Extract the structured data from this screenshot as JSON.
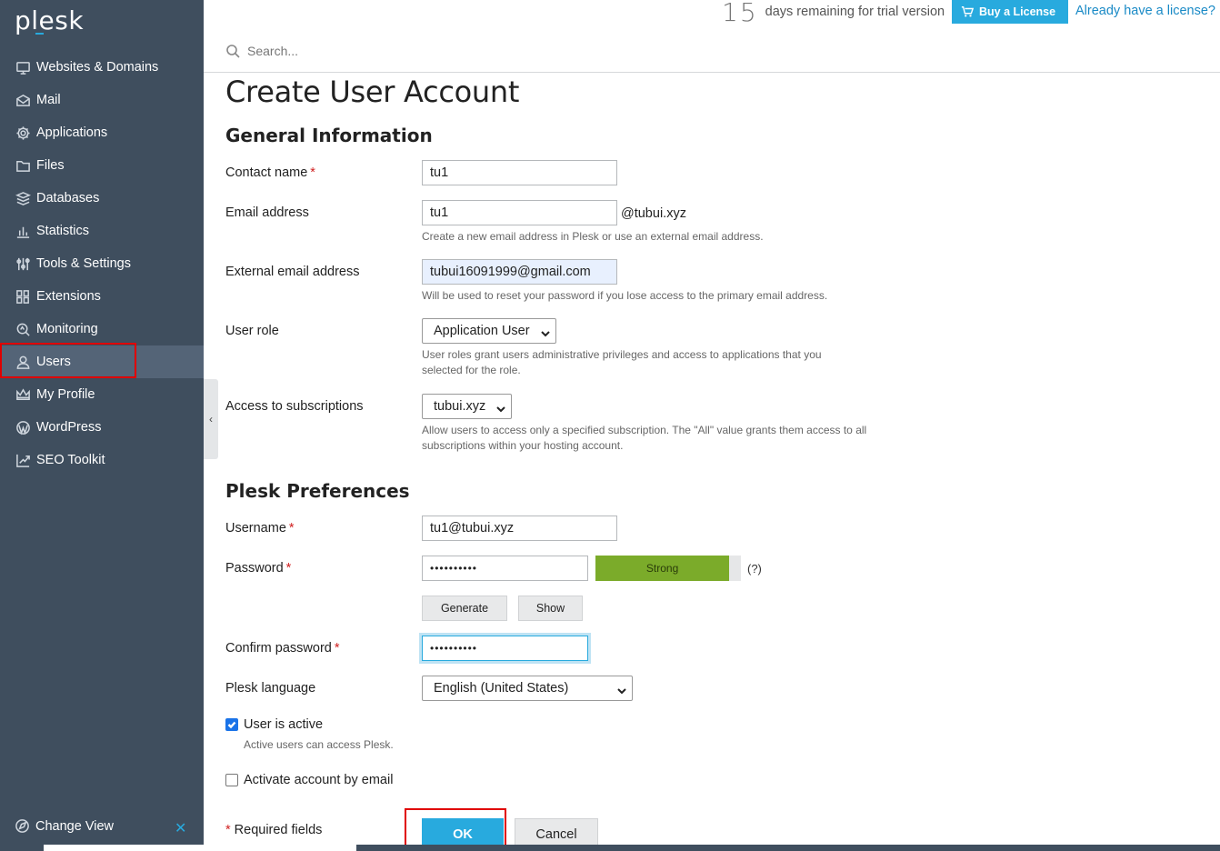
{
  "app": {
    "logo": "plesk"
  },
  "topbar": {
    "trial_days": "15",
    "trial_text": "days remaining for trial version",
    "buy_label": "Buy a License",
    "already_label": "Already have a license?"
  },
  "search": {
    "placeholder": "Search..."
  },
  "sidebar": {
    "items": [
      {
        "label": "Websites & Domains",
        "icon": "monitor-icon"
      },
      {
        "label": "Mail",
        "icon": "mail-icon"
      },
      {
        "label": "Applications",
        "icon": "gear-icon"
      },
      {
        "label": "Files",
        "icon": "folder-icon"
      },
      {
        "label": "Databases",
        "icon": "database-icon"
      },
      {
        "label": "Statistics",
        "icon": "bar-chart-icon"
      },
      {
        "label": "Tools & Settings",
        "icon": "sliders-icon"
      },
      {
        "label": "Extensions",
        "icon": "grid-icon"
      },
      {
        "label": "Monitoring",
        "icon": "magnifier-icon"
      },
      {
        "label": "Users",
        "icon": "user-icon",
        "active": true
      },
      {
        "label": "My Profile",
        "icon": "crown-icon"
      },
      {
        "label": "WordPress",
        "icon": "wordpress-icon"
      },
      {
        "label": "SEO Toolkit",
        "icon": "seo-chart-icon"
      }
    ],
    "change_view": "Change View",
    "close_symbol": "✕"
  },
  "form": {
    "title": "Create User Account",
    "general_heading": "General Information",
    "contact_name": {
      "label": "Contact name",
      "value": "tu1"
    },
    "email": {
      "label": "Email address",
      "value": "tu1",
      "suffix": "@tubui.xyz",
      "hint": "Create a new email address in Plesk or use an external email address."
    },
    "external_email": {
      "label": "External email address",
      "value": "tubui16091999@gmail.com",
      "hint": "Will be used to reset your password if you lose access to the primary email address."
    },
    "user_role": {
      "label": "User role",
      "value": "Application User",
      "hint": "User roles grant users administrative privileges and access to applications that you selected for the role."
    },
    "subscriptions": {
      "label": "Access to subscriptions",
      "value": "tubui.xyz",
      "hint": "Allow users to access only a specified subscription. The \"All\" value grants them access to all subscriptions within your hosting account."
    },
    "prefs_heading": "Plesk Preferences",
    "username": {
      "label": "Username",
      "value": "tu1@tubui.xyz"
    },
    "password": {
      "label": "Password",
      "value": "••••••••••",
      "strength": "Strong",
      "strength_fraction": 0.92,
      "help": "(?)"
    },
    "generate_label": "Generate",
    "show_label": "Show",
    "confirm_password": {
      "label": "Confirm password",
      "value": "••••••••••"
    },
    "language": {
      "label": "Plesk language",
      "value": "English (United States)"
    },
    "user_active": {
      "label": "User is active",
      "checked": true,
      "hint": "Active users can access Plesk."
    },
    "activate_email": {
      "label": "Activate account by email",
      "checked": false
    },
    "required_note": "Required fields",
    "required_star": "*",
    "ok_label": "OK",
    "cancel_label": "Cancel"
  },
  "colors": {
    "sidebar_bg": "#3f4e5e",
    "accent": "#28aade",
    "highlight": "#e00000",
    "strength_fill": "#7bab2a"
  }
}
